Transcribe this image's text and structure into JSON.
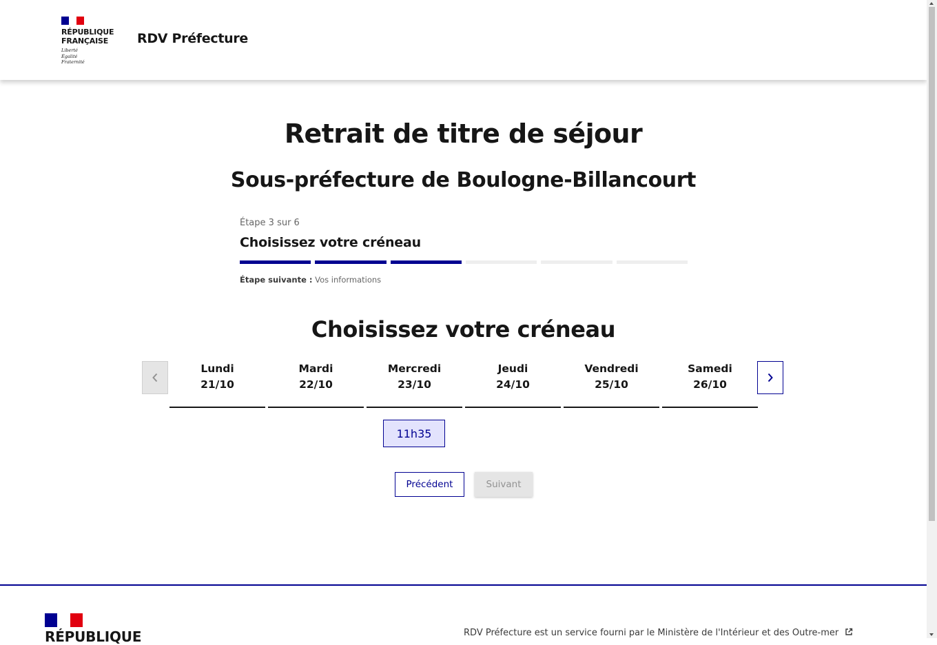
{
  "header": {
    "logo": {
      "name_line1": "RÉPUBLIQUE",
      "name_line2": "FRANÇAISE",
      "motto": [
        "Liberté",
        "Égalité",
        "Fraternité"
      ]
    },
    "service_title": "RDV Préfecture"
  },
  "page": {
    "title": "Retrait de titre de séjour",
    "subtitle": "Sous-préfecture de Boulogne-Billancourt"
  },
  "stepper": {
    "state": "Étape 3 sur 6",
    "title": "Choisissez votre créneau",
    "current_step": 3,
    "total_steps": 6,
    "next_label": "Étape suivante :",
    "next_value": "Vos informations"
  },
  "calendar": {
    "title": "Choisissez votre créneau",
    "days": [
      {
        "name": "Lundi",
        "date": "21/10"
      },
      {
        "name": "Mardi",
        "date": "22/10"
      },
      {
        "name": "Mercredi",
        "date": "23/10"
      },
      {
        "name": "Jeudi",
        "date": "24/10"
      },
      {
        "name": "Vendredi",
        "date": "25/10"
      },
      {
        "name": "Samedi",
        "date": "26/10"
      }
    ],
    "slot": {
      "day": "Mercredi",
      "time": "11h35"
    }
  },
  "actions": {
    "previous_label": "Précédent",
    "next_label": "Suivant"
  },
  "footer": {
    "rf_line1": "RÉPUBLIQUE",
    "description": "RDV Préfecture est un service fourni par le Ministère de l'Intérieur et des Outre-mer"
  },
  "colors": {
    "primary": "#000091",
    "slot_bg": "#e3e3fd",
    "disabled_bg": "#e5e5e5",
    "flag_red": "#e1000f"
  },
  "icons": [
    "chevron-left-icon",
    "chevron-right-icon",
    "external-link-icon"
  ]
}
